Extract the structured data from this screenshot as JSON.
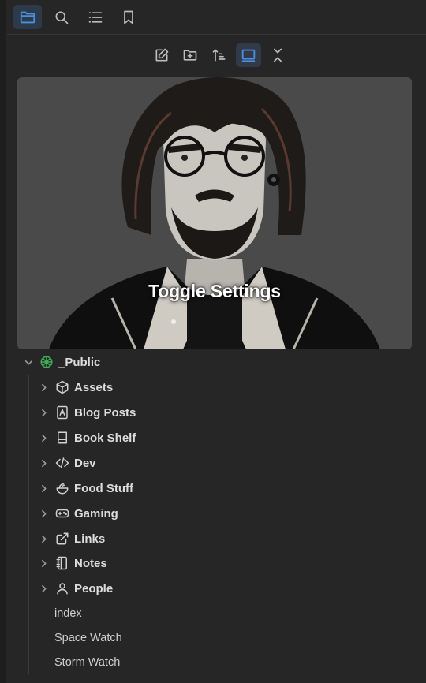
{
  "sidebar_tabs": [
    {
      "icon": "folder-icon",
      "active": true
    },
    {
      "icon": "search-icon",
      "active": false
    },
    {
      "icon": "list-icon",
      "active": false
    },
    {
      "icon": "bookmark-icon",
      "active": false
    }
  ],
  "nav_actions": [
    {
      "icon": "new-note-icon",
      "active": false
    },
    {
      "icon": "new-folder-icon",
      "active": false
    },
    {
      "icon": "sort-icon",
      "active": false
    },
    {
      "icon": "auto-reveal-icon",
      "active": true
    },
    {
      "icon": "collapse-all-icon",
      "active": false
    }
  ],
  "banner": {
    "text": "Toggle Settings"
  },
  "tree": {
    "root": {
      "label": "_Public",
      "icon": "vault-icon",
      "icon_color": "#3fae5a",
      "expanded": true
    },
    "folders": [
      {
        "label": "Assets",
        "icon": "box-icon"
      },
      {
        "label": "Blog Posts",
        "icon": "blog-icon"
      },
      {
        "label": "Book Shelf",
        "icon": "book-icon"
      },
      {
        "label": "Dev",
        "icon": "code-icon"
      },
      {
        "label": "Food Stuff",
        "icon": "food-icon"
      },
      {
        "label": "Gaming",
        "icon": "gamepad-icon"
      },
      {
        "label": "Links",
        "icon": "external-link-icon"
      },
      {
        "label": "Notes",
        "icon": "notebook-icon"
      },
      {
        "label": "People",
        "icon": "person-icon"
      }
    ],
    "files": [
      {
        "label": "index"
      },
      {
        "label": "Space Watch"
      },
      {
        "label": "Storm Watch"
      }
    ]
  },
  "colors": {
    "background": "#262626",
    "accent": "#4a8fe0",
    "text": "#dcdcdc"
  }
}
